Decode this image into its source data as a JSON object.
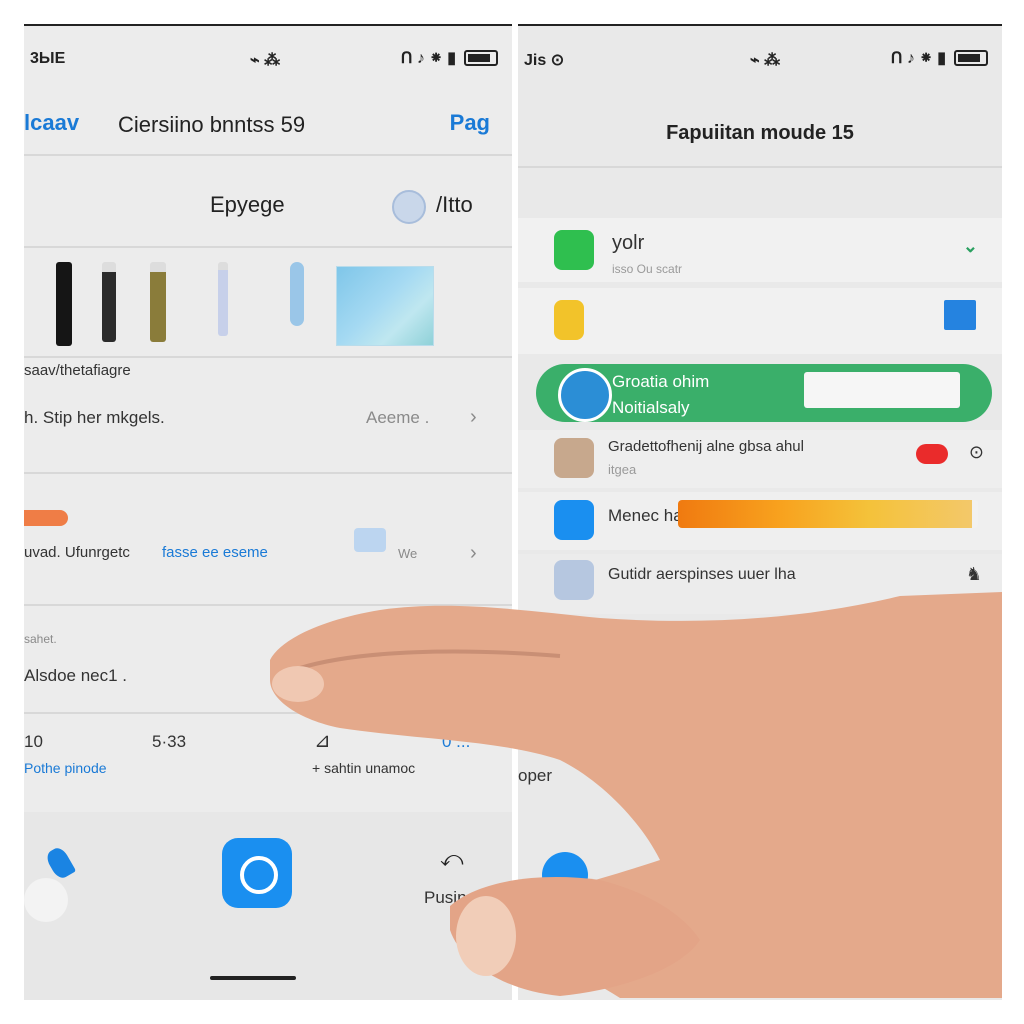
{
  "left": {
    "status": {
      "time": "3ЫЕ",
      "center": "⌁ ⁂",
      "icons": "ᑎ ♪ ⁕ ▮"
    },
    "nav": {
      "back": "lcaav",
      "title": "Ciersiino bnntss 59",
      "action": "Pag"
    },
    "section": {
      "title": "Epyege",
      "action": "/Itto"
    },
    "products_label": "saav/thetafiagre",
    "row1": {
      "label": "h. Stip her mkgels.",
      "value": "Aeeme ."
    },
    "row2": {
      "label": "uvad. Ufunrgetc",
      "link": "fasse ee eseme",
      "value": "We"
    },
    "row3": {
      "small": "sahet.",
      "label": "Alsdoe nec1 ."
    },
    "stats": {
      "left_val": "10",
      "mid_val": "5·33",
      "left_link": "Pothe pinode",
      "mid_icon": "⊿",
      "mid_label": "+ sahtin unamoc",
      "right_val": "0 ..."
    },
    "tabbar": {
      "right_icon": "⤺",
      "right_label": "Pusin"
    }
  },
  "right": {
    "status": {
      "time": "Jis ⊙",
      "center": "⌁ ⁂",
      "icons": "ᑎ ♪ ⁕ ▮"
    },
    "title": "Fapuiitan moude 15",
    "row1": {
      "label": "yolr",
      "sub": "isso Ou scatr"
    },
    "highlight": {
      "line1": "Groatia ohim",
      "line2": "Noitialsaly"
    },
    "row3": {
      "label": "Gradettofhenij alne gbsa ahul",
      "sub": "itgea"
    },
    "row4": {
      "label": "Menec ha",
      "progress": 0.98
    },
    "row5": {
      "label": "Gutidr aerspinses uuer lha"
    },
    "partial": "oper"
  }
}
